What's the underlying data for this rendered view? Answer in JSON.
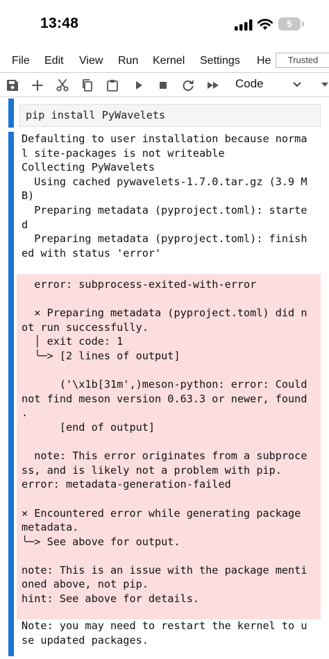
{
  "status_bar": {
    "time": "13:48",
    "battery": "5"
  },
  "menu": {
    "items": [
      "File",
      "Edit",
      "View",
      "Run",
      "Kernel",
      "Settings",
      "He"
    ],
    "trusted": "Trusted"
  },
  "toolbar": {
    "cell_type": "Code"
  },
  "input_cell": {
    "code": "pip install PyWavelets"
  },
  "output": {
    "stdout_lines": [
      "Defaulting to user installation because norma",
      "l site-packages is not writeable",
      "Collecting PyWavelets",
      "  Using cached pywavelets-1.7.0.tar.gz (3.9 M",
      "B)",
      "  Preparing metadata (pyproject.toml): starte",
      "d",
      "  Preparing metadata (pyproject.toml): finish",
      "ed with status 'error'"
    ],
    "stderr_lines": [
      "  error: subprocess-exited-with-error",
      "",
      "  × Preparing metadata (pyproject.toml) did n",
      "ot run successfully.",
      "  │ exit code: 1",
      "  ╰─> [2 lines of output]",
      "",
      "      ('\\x1b[31m',)meson-python: error: Could",
      "not find meson version 0.63.3 or newer, found",
      ".",
      "      [end of output]",
      "",
      "  note: This error originates from a subproce",
      "ss, and is likely not a problem with pip.",
      "error: metadata-generation-failed",
      "",
      "× Encountered error while generating package",
      "metadata.",
      "╰─> See above for output.",
      "",
      "note: This is an issue with the package menti",
      "oned above, not pip.",
      "hint: See above for details."
    ],
    "note_lines": [
      "Note: you may need to restart the kernel to u",
      "se updated packages."
    ]
  }
}
